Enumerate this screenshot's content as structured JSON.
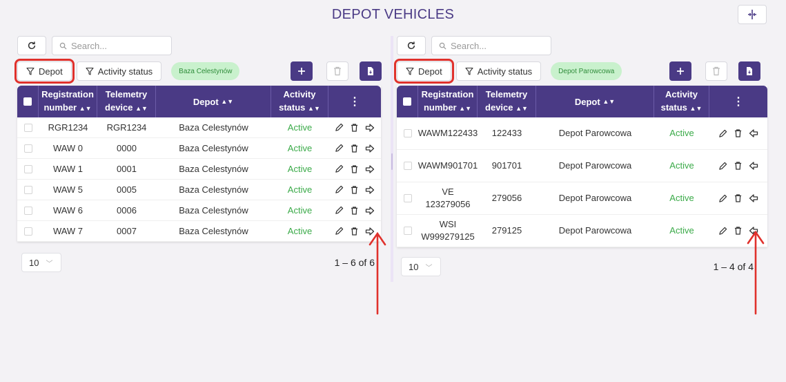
{
  "page": {
    "title": "DEPOT VEHICLES"
  },
  "colors": {
    "primary": "#4a3a85",
    "active": "#3aaa48",
    "chip_bg": "#c9f1cd",
    "highlight": "#e0312c"
  },
  "left": {
    "search_placeholder": "Search...",
    "filter_depot": "Depot",
    "filter_activity": "Activity status",
    "chip": "Baza Celestynów",
    "columns": [
      "Registration number",
      "Telemetry device",
      "Depot",
      "Activity status"
    ],
    "rows": [
      {
        "reg": "RGR1234",
        "tel": "RGR1234",
        "depot": "Baza Celestynów",
        "status": "Active"
      },
      {
        "reg": "WAW 0",
        "tel": "0000",
        "depot": "Baza Celestynów",
        "status": "Active"
      },
      {
        "reg": "WAW 1",
        "tel": "0001",
        "depot": "Baza Celestynów",
        "status": "Active"
      },
      {
        "reg": "WAW 5",
        "tel": "0005",
        "depot": "Baza Celestynów",
        "status": "Active"
      },
      {
        "reg": "WAW 6",
        "tel": "0006",
        "depot": "Baza Celestynów",
        "status": "Active"
      },
      {
        "reg": "WAW 7",
        "tel": "0007",
        "depot": "Baza Celestynów",
        "status": "Active"
      }
    ],
    "page_size": "10",
    "range": "1 – 6 of 6"
  },
  "right": {
    "search_placeholder": "Search...",
    "filter_depot": "Depot",
    "filter_activity": "Activity status",
    "chip": "Depot Parowcowa",
    "columns": [
      "Registration number",
      "Telemetry device",
      "Depot",
      "Activity status"
    ],
    "rows": [
      {
        "reg": "WAWM122433",
        "tel": "122433",
        "depot": "Depot Parowcowa",
        "status": "Active"
      },
      {
        "reg": "WAWM901701",
        "tel": "901701",
        "depot": "Depot Parowcowa",
        "status": "Active"
      },
      {
        "reg": "VE 123279056",
        "tel": "279056",
        "depot": "Depot Parowcowa",
        "status": "Active"
      },
      {
        "reg": "WSI W999279125",
        "tel": "279125",
        "depot": "Depot Parowcowa",
        "status": "Active"
      }
    ],
    "page_size": "10",
    "range": "1 – 4 of 4"
  },
  "icons": [
    "refresh-icon",
    "search-icon",
    "filter-icon",
    "plus-icon",
    "trash-icon",
    "export-icon",
    "pencil-icon",
    "arrow-right-icon",
    "arrow-left-icon",
    "sort-icon",
    "more-vert-icon",
    "split-view-icon",
    "chevron-down-icon"
  ]
}
